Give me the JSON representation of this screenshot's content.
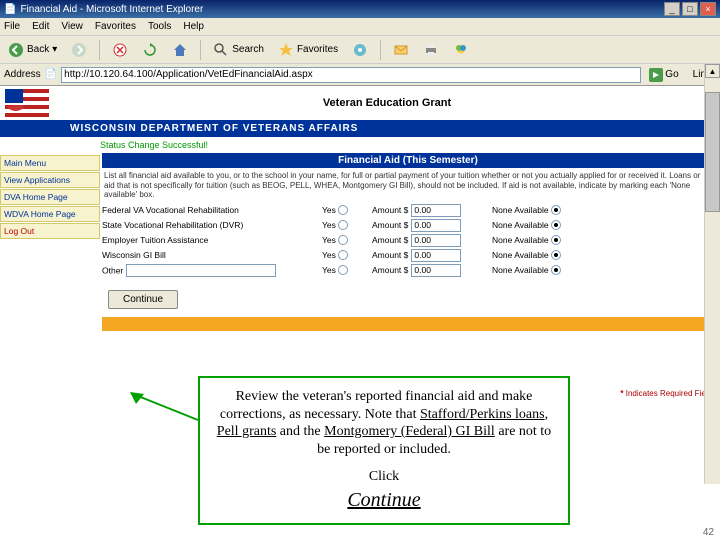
{
  "window": {
    "title": "Financial Aid - Microsoft Internet Explorer",
    "min": "_",
    "max": "□",
    "close": "×"
  },
  "menu": [
    "File",
    "Edit",
    "View",
    "Favorites",
    "Tools",
    "Help"
  ],
  "toolbar": {
    "back": "Back",
    "search": "Search",
    "favorites": "Favorites"
  },
  "address": {
    "label": "Address",
    "url": "http://10.120.64.100/Application/VetEdFinancialAid.aspx",
    "go": "Go",
    "links": "Links"
  },
  "page": {
    "title": "Veteran Education Grant",
    "dept": "WISCONSIN DEPARTMENT OF VETERANS AFFAIRS",
    "status": "Status Change Successful!",
    "section": "Financial Aid (This Semester)",
    "help": "?",
    "instructions": "List all financial aid available to you, or to the school in your name, for full or partial payment of your tuition whether or not you actually applied for or received it. Loans or aid that is not specifically for tuition (such as BEOG, PELL, WHEA, Montgomery GI Bill), should not be included. If aid is not available, indicate by marking each 'None available' box.",
    "rows": [
      {
        "label": "Federal VA Vocational Rehabilitation",
        "yes": "Yes",
        "amount_label": "Amount $",
        "amount": "0.00",
        "none": "None Available"
      },
      {
        "label": "State Vocational Rehabilitation (DVR)",
        "yes": "Yes",
        "amount_label": "Amount $",
        "amount": "0.00",
        "none": "None Available"
      },
      {
        "label": "Employer Tuition Assistance",
        "yes": "Yes",
        "amount_label": "Amount $",
        "amount": "0.00",
        "none": "None Available"
      },
      {
        "label": "Wisconsin GI Bill",
        "yes": "Yes",
        "amount_label": "Amount $",
        "amount": "0.00",
        "none": "None Available"
      },
      {
        "label": "Other",
        "yes": "Yes",
        "amount_label": "Amount $",
        "amount": "0.00",
        "none": "None Available"
      }
    ],
    "continue": "Continue",
    "required_note": "Indicates Required Field"
  },
  "callout": {
    "line1a": "Review the veteran's reported financial aid and make corrections, as necessary.  Note that ",
    "u1": "Stafford/Perkins loans",
    "sep1": ", ",
    "u2": "Pell grants",
    "sep2": " and the ",
    "u3": "Montgomery (Federal) GI Bill",
    "line1b": " are not to be reported or included.",
    "click": "Click",
    "continue": "Continue"
  },
  "slide_number": "42"
}
